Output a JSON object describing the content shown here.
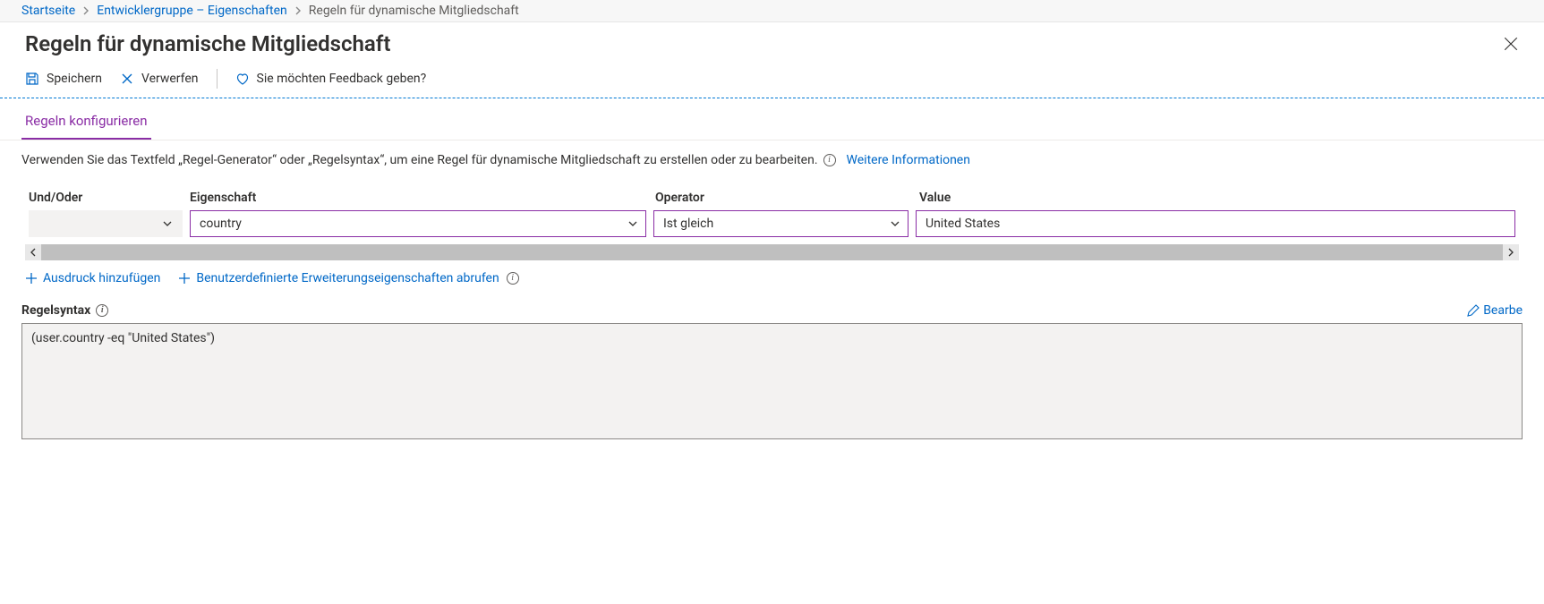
{
  "breadcrumb": {
    "home": "Startseite",
    "group": "Entwicklergruppe – Eigenschaften",
    "current": "Regeln für dynamische Mitgliedschaft"
  },
  "page_title": "Regeln für dynamische Mitgliedschaft",
  "toolbar": {
    "save": "Speichern",
    "discard": "Verwerfen",
    "feedback": "Sie möchten Feedback geben?"
  },
  "tabs": {
    "configure": "Regeln konfigurieren"
  },
  "info_text": "Verwenden Sie das Textfeld „Regel-Generator“ oder „Regelsyntax“, um eine Regel für dynamische Mitgliedschaft zu erstellen oder zu bearbeiten.",
  "info_link": "Weitere Informationen",
  "builder": {
    "headers": {
      "andor": "Und/Oder",
      "property": "Eigenschaft",
      "operator": "Operator",
      "value": "Value"
    },
    "row": {
      "property": "country",
      "operator": "Ist gleich",
      "value": "United States"
    }
  },
  "actions": {
    "add_expression": "Ausdruck hinzufügen",
    "get_extensions": "Benutzerdefinierte Erweiterungseigenschaften abrufen"
  },
  "syntax": {
    "label": "Regelsyntax",
    "edit": "Bearbe",
    "value": "(user.country -eq \"United States\")"
  }
}
